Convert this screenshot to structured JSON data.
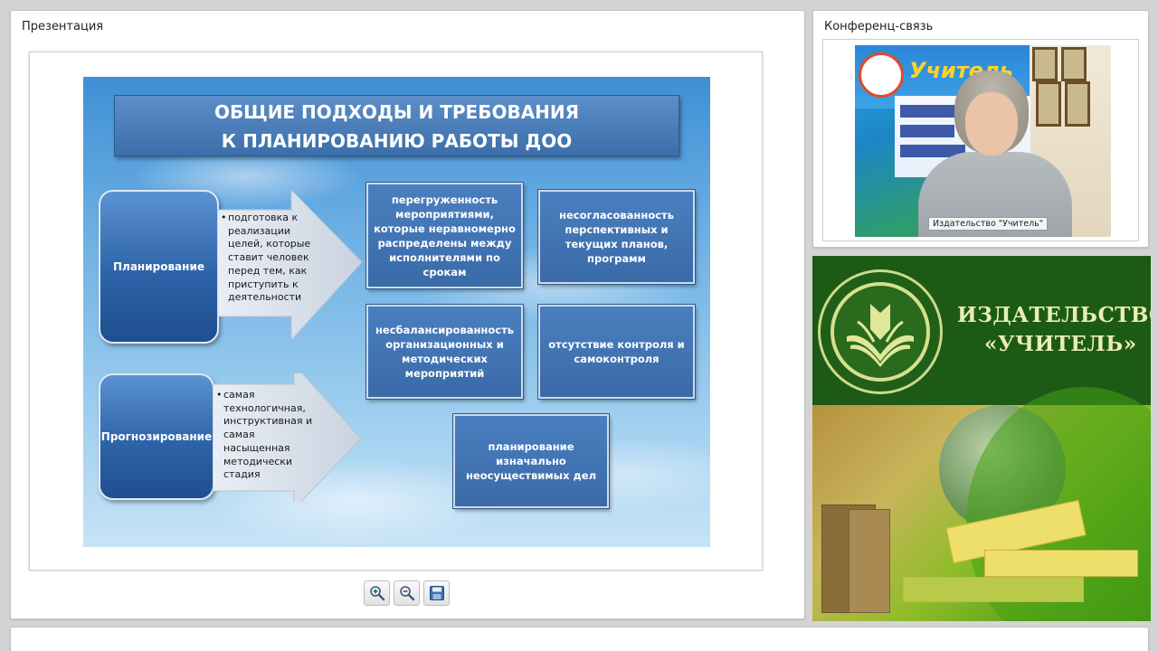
{
  "presentation_panel": {
    "title": "Презентация"
  },
  "conference_panel": {
    "title": "Конференц-связь",
    "video_caption": "Издательство \"Учитель\""
  },
  "slide": {
    "title_line1": "ОБЩИЕ ПОДХОДЫ И ТРЕБОВАНИЯ",
    "title_line2": "К ПЛАНИРОВАНИЮ РАБОТЫ ДОО",
    "planning_label": "Планирование",
    "planning_bullet": "подготовка к реализации целей, которые ставит человек перед тем, как приступить к деятельности",
    "forecast_label": "Прогнозирование",
    "forecast_bullet": "самая технологичная, инструктивная и самая насыщенная методически стадия",
    "box_a": "перегруженность мероприятиями, которые неравномерно распределены между исполнителями по срокам",
    "box_b": "несогласованность перспективных и текущих планов, программ",
    "box_c": "несбалансированность организационных и методических мероприятий",
    "box_d": "отсутствие контроля и самоконтроля",
    "box_e": "планирование изначально неосуществимых дел",
    "bullet_symbol": "•"
  },
  "toolbar": {
    "zoom_in_icon": "zoom-in-icon",
    "zoom_out_icon": "zoom-out-icon",
    "save_icon": "save-icon"
  },
  "ad": {
    "name_line1": "ИЗДАТЕЛЬСТВО",
    "name_line2": "«УЧИТЕЛЬ»",
    "video_logo_text": "Учитель"
  },
  "colors": {
    "slide_box": "#3a6aa8",
    "ad_green": "#1d5a15",
    "ad_text": "#e8efb0"
  }
}
